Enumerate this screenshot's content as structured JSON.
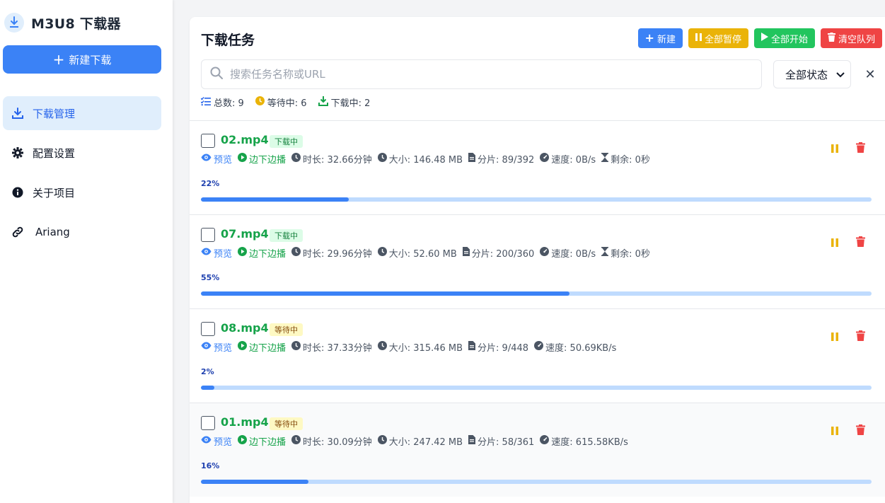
{
  "app": {
    "title": "M3U8 下载器",
    "new_download_label": "新建下载",
    "accent": "#3b82f6"
  },
  "sidebar": {
    "items": [
      {
        "label": "下载管理",
        "icon": "download-icon",
        "active": true
      },
      {
        "label": "配置设置",
        "icon": "gear-icon",
        "active": false
      },
      {
        "label": "关于项目",
        "icon": "info-icon",
        "active": false
      },
      {
        "label": "Ariang",
        "icon": "link-icon",
        "active": false
      }
    ]
  },
  "main": {
    "title": "下载任务",
    "toolbar": {
      "new_label": "新建",
      "pause_all_label": "全部暂停",
      "start_all_label": "全部开始",
      "clear_label": "清空队列"
    },
    "search": {
      "placeholder": "搜索任务名称或URL",
      "value": ""
    },
    "status_filter": {
      "selected": "全部状态"
    },
    "clear_symbol": "✕",
    "stats": {
      "total": "总数: 9",
      "waiting": "等待中: 6",
      "downloading": "下载中: 2"
    }
  },
  "meta_labels": {
    "preview": "预览",
    "play": "边下边播"
  },
  "tasks": [
    {
      "name": "02.mp4",
      "status": "下载中",
      "status_kind": "downloading",
      "duration": "时长: 32.66分钟",
      "size": "大小: 146.48 MB",
      "segments": "分片: 89/392",
      "speed": "速度: 0B/s",
      "remaining": "剩余: 0秒",
      "percent_label": "22%",
      "progress": 0.22
    },
    {
      "name": "07.mp4",
      "status": "下载中",
      "status_kind": "downloading",
      "duration": "时长: 29.96分钟",
      "size": "大小: 52.60 MB",
      "segments": "分片: 200/360",
      "speed": "速度: 0B/s",
      "remaining": "剩余: 0秒",
      "percent_label": "55%",
      "progress": 0.55
    },
    {
      "name": "08.mp4",
      "status": "等待中",
      "status_kind": "waiting",
      "duration": "时长: 37.33分钟",
      "size": "大小: 315.46 MB",
      "segments": "分片: 9/448",
      "speed": "速度: 50.69KB/s",
      "remaining": null,
      "percent_label": "2%",
      "progress": 0.02
    },
    {
      "name": "01.mp4",
      "status": "等待中",
      "status_kind": "waiting",
      "duration": "时长: 30.09分钟",
      "size": "大小: 247.42 MB",
      "segments": "分片: 58/361",
      "speed": "速度: 615.58KB/s",
      "remaining": null,
      "percent_label": "16%",
      "progress": 0.16
    }
  ]
}
